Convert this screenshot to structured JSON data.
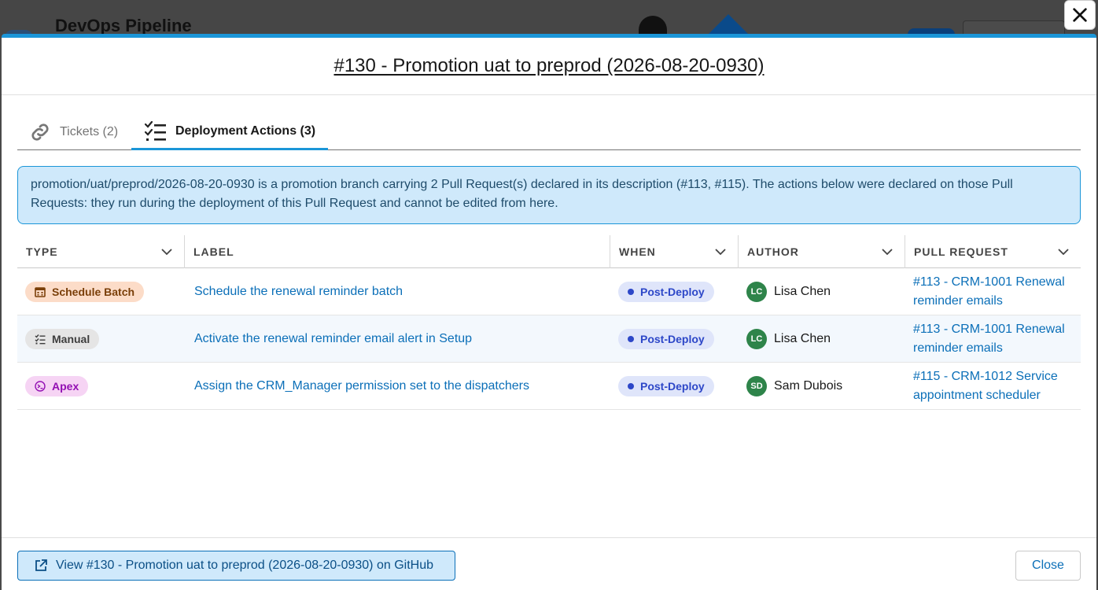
{
  "background": {
    "app_title": "DevOps Pipeline"
  },
  "modal": {
    "title": "#130 - Promotion uat to preprod (2026-08-20-0930)",
    "tabs": [
      {
        "label": "Tickets (2)",
        "icon": "link-icon",
        "active": false
      },
      {
        "label": "Deployment Actions (3)",
        "icon": "checklist-icon",
        "active": true
      }
    ],
    "info_text": "promotion/uat/preprod/2026-08-20-0930 is a promotion branch carrying 2 Pull Request(s) declared in its description (#113, #115). The actions below were declared on those Pull Requests: they run during the deployment of this Pull Request and cannot be edited from here.",
    "table": {
      "columns": [
        "TYPE",
        "LABEL",
        "WHEN",
        "AUTHOR",
        "PULL REQUEST"
      ],
      "rows": [
        {
          "type": "Schedule Batch",
          "type_icon": "calendar-icon",
          "label": "Schedule the renewal reminder batch",
          "when": "Post-Deploy",
          "author_initials": "LC",
          "author": "Lisa Chen",
          "pr_line1": "#113 - CRM-1001 Renewal",
          "pr_line2": "reminder emails"
        },
        {
          "type": "Manual",
          "type_icon": "checklist-icon",
          "label": "Activate the renewal reminder email alert in Setup",
          "when": "Post-Deploy",
          "author_initials": "LC",
          "author": "Lisa Chen",
          "pr_line1": "#113 - CRM-1001 Renewal",
          "pr_line2": "reminder emails"
        },
        {
          "type": "Apex",
          "type_icon": "apex-icon",
          "label": "Assign the CRM_Manager permission set to the dispatchers",
          "when": "Post-Deploy",
          "author_initials": "SD",
          "author": "Sam Dubois",
          "pr_line1": "#115 - CRM-1012 Service",
          "pr_line2": "appointment scheduler"
        }
      ]
    },
    "footer": {
      "github_button": "View #130 - Promotion uat to preprod (2026-08-20-0930) on GitHub",
      "close_button": "Close"
    }
  },
  "colors": {
    "accent": "#1b96d8",
    "link": "#0b6fb8",
    "info_bg": "#cfe9fb",
    "author_avatar": "#2e844a"
  }
}
